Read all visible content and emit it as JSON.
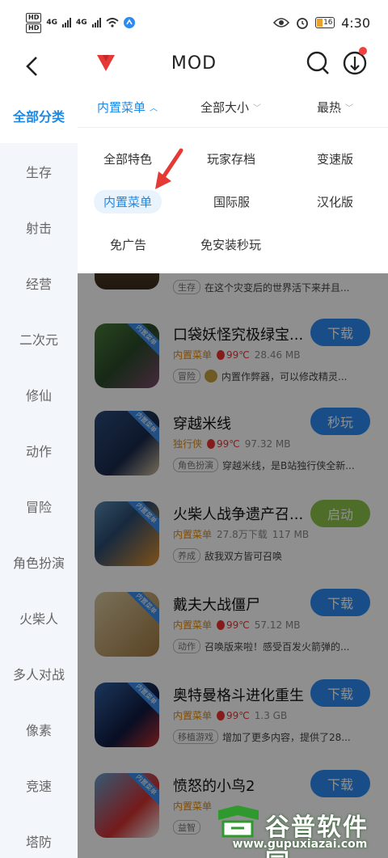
{
  "status_bar": {
    "left_badges": [
      "HD",
      "HD"
    ],
    "network_1": "4G",
    "network_2": "4G",
    "battery": "16",
    "time": "4:30"
  },
  "header": {
    "title": "MOD",
    "icons": [
      "back-icon",
      "search-icon",
      "download-icon"
    ]
  },
  "sidebar": {
    "items": [
      "全部分类",
      "生存",
      "射击",
      "经营",
      "二次元",
      "修仙",
      "动作",
      "冒险",
      "角色扮演",
      "火柴人",
      "多人对战",
      "像素",
      "竞速",
      "塔防"
    ],
    "active_index": 0
  },
  "filters": [
    {
      "label": "内置菜单",
      "active": true
    },
    {
      "label": "全部大小",
      "active": false
    },
    {
      "label": "最热",
      "active": false
    }
  ],
  "dropdown": {
    "tags": [
      "全部特色",
      "玩家存档",
      "变速版",
      "内置菜单",
      "国际服",
      "汉化版",
      "免广告",
      "免安装秒玩"
    ],
    "selected": "内置菜单"
  },
  "games": [
    {
      "name": "",
      "type": "",
      "temp": "",
      "size": "",
      "tag": "生存",
      "desc": "在这个灾变后的世界活下来并且...",
      "action": "",
      "partial": true
    },
    {
      "name": "口袋妖怪究极绿宝...",
      "corner": "内置菜单",
      "type": "内置菜单",
      "temp": "99℃",
      "size": "28.46 MB",
      "tag": "冒险",
      "desc": "内置作弊器，可以修改精灵...",
      "action": "下载"
    },
    {
      "name": "穿越米线",
      "corner": "内置菜单",
      "type": "独行侠",
      "temp": "99℃",
      "size": "97.32 MB",
      "tag": "角色扮演",
      "desc": "穿越米线，是B站独行侠全新...",
      "action": "秒玩"
    },
    {
      "name": "火柴人战争遗产召...",
      "corner": "内置菜单",
      "type": "内置菜单",
      "temp": "27.8万下载",
      "size": "117 MB",
      "tag": "养成",
      "desc": "敌我双方皆可召唤",
      "action": "启动"
    },
    {
      "name": "戴夫大战僵尸",
      "corner": "内置菜单",
      "type": "内置菜单",
      "temp": "99℃",
      "size": "57.12 MB",
      "tag": "动作",
      "desc": "召唤版来啦！感受百发火箭弹的...",
      "action": "下载"
    },
    {
      "name": "奥特曼格斗进化重生",
      "corner": "内置菜单",
      "type": "内置菜单",
      "temp": "99℃",
      "size": "1.3 GB",
      "tag": "移植游戏",
      "desc": "增加了更多内容，提供了28...",
      "action": "下载"
    },
    {
      "name": "愤怒的小鸟2",
      "corner": "内置菜单",
      "type": "内置菜单",
      "temp": "",
      "size": "",
      "tag": "益智",
      "desc": "",
      "action": "下载"
    }
  ],
  "watermark": {
    "text": "谷普软件园",
    "url": "www.gupuxiazai.com"
  },
  "colors": {
    "accent": "#1e88e5",
    "button_blue": "#2d8af0",
    "button_green": "#8bc34a",
    "type_orange": "#e88a00",
    "temp_red": "#ee3333",
    "annotation_arrow": "#e53935"
  }
}
